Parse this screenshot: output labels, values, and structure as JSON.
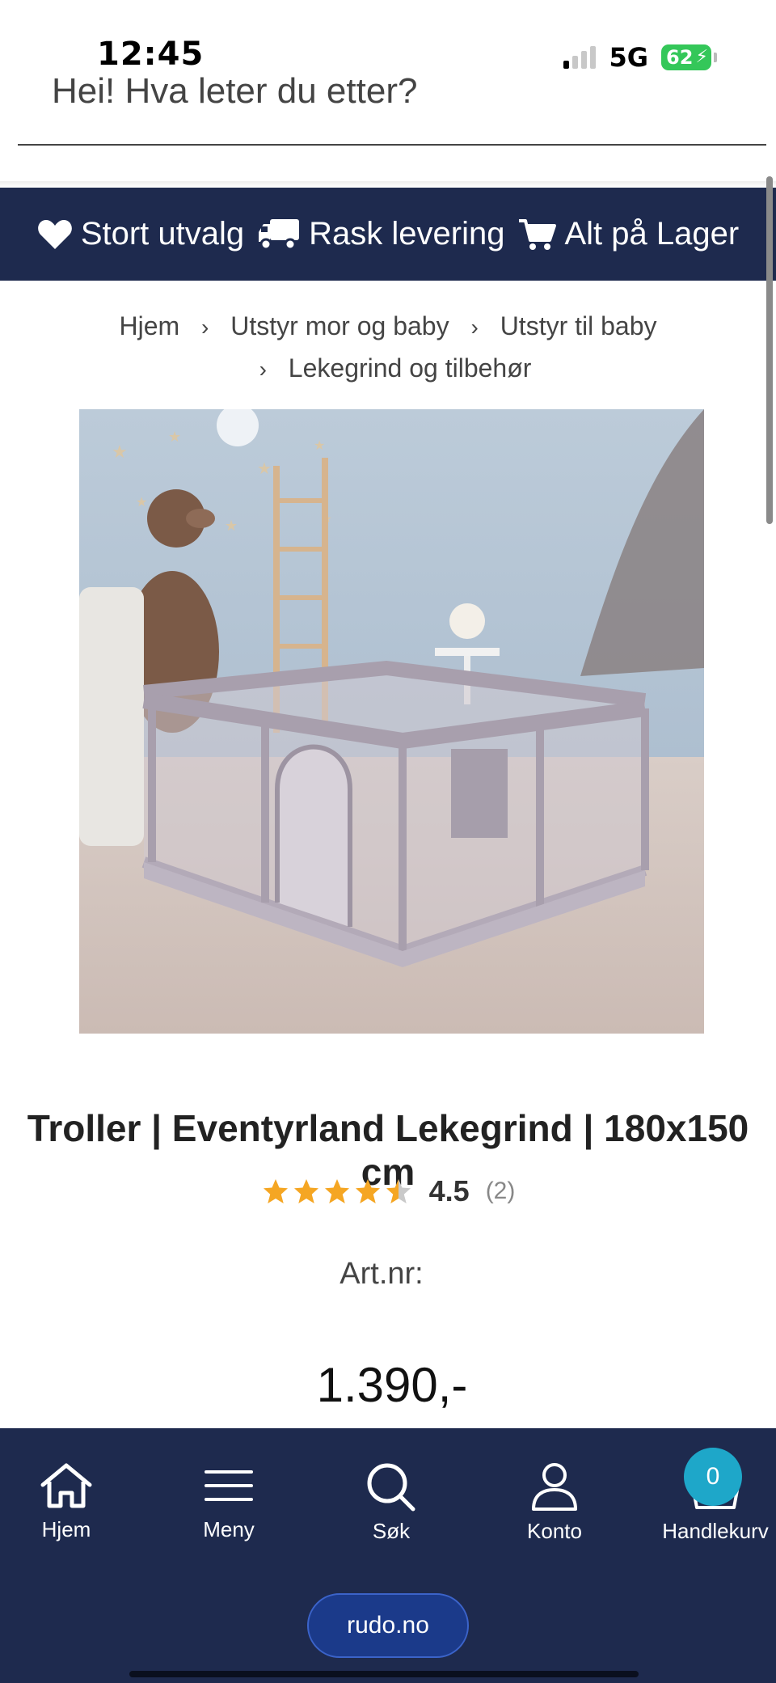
{
  "status_bar": {
    "time": "12:45",
    "network": "5G",
    "battery": "62"
  },
  "search": {
    "placeholder": "Hei! Hva leter du etter?"
  },
  "usp": {
    "items": [
      {
        "icon": "heart-icon",
        "label": "Stort utvalg"
      },
      {
        "icon": "truck-icon",
        "label": "Rask levering"
      },
      {
        "icon": "cart-icon",
        "label": "Alt på Lager"
      }
    ]
  },
  "breadcrumb": {
    "items": [
      "Hjem",
      "Utstyr mor og baby",
      "Utstyr til baby",
      "Lekegrind og tilbehør"
    ],
    "separator": "›"
  },
  "product": {
    "image_alt": "Lekegrind",
    "title": "Troller | Eventyrland Lekegrind | 180x150 cm",
    "rating_value": "4.5",
    "rating_stars": 4.5,
    "rating_max": 5,
    "rating_count": "(2)",
    "artnr_label": "Art.nr:",
    "price": "1.390,-"
  },
  "bottom_nav": {
    "items": [
      {
        "icon": "home-icon",
        "label": "Hjem"
      },
      {
        "icon": "menu-icon",
        "label": "Meny"
      },
      {
        "icon": "search-icon",
        "label": "Søk"
      },
      {
        "icon": "user-icon",
        "label": "Konto"
      },
      {
        "icon": "basket-icon",
        "label": "Handlekurv"
      }
    ],
    "cart_count": "0",
    "site_url": "rudo.no"
  },
  "colors": {
    "brand_navy": "#1e2a4e",
    "star": "#f5a623",
    "badge": "#1ea7c9",
    "battery": "#34c759"
  }
}
